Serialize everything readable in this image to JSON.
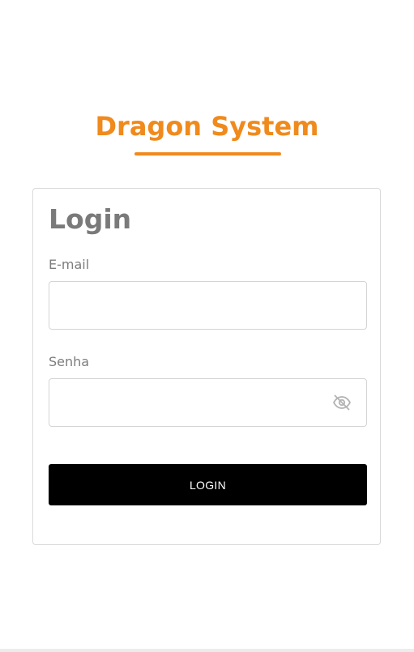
{
  "brand": {
    "title": "Dragon System",
    "accent_color": "#f08a1c"
  },
  "login_card": {
    "title": "Login",
    "email": {
      "label": "E-mail",
      "value": "",
      "placeholder": ""
    },
    "password": {
      "label": "Senha",
      "value": "",
      "placeholder": "",
      "toggle_icon": "eye-off-icon"
    },
    "submit_label": "LOGIN"
  }
}
